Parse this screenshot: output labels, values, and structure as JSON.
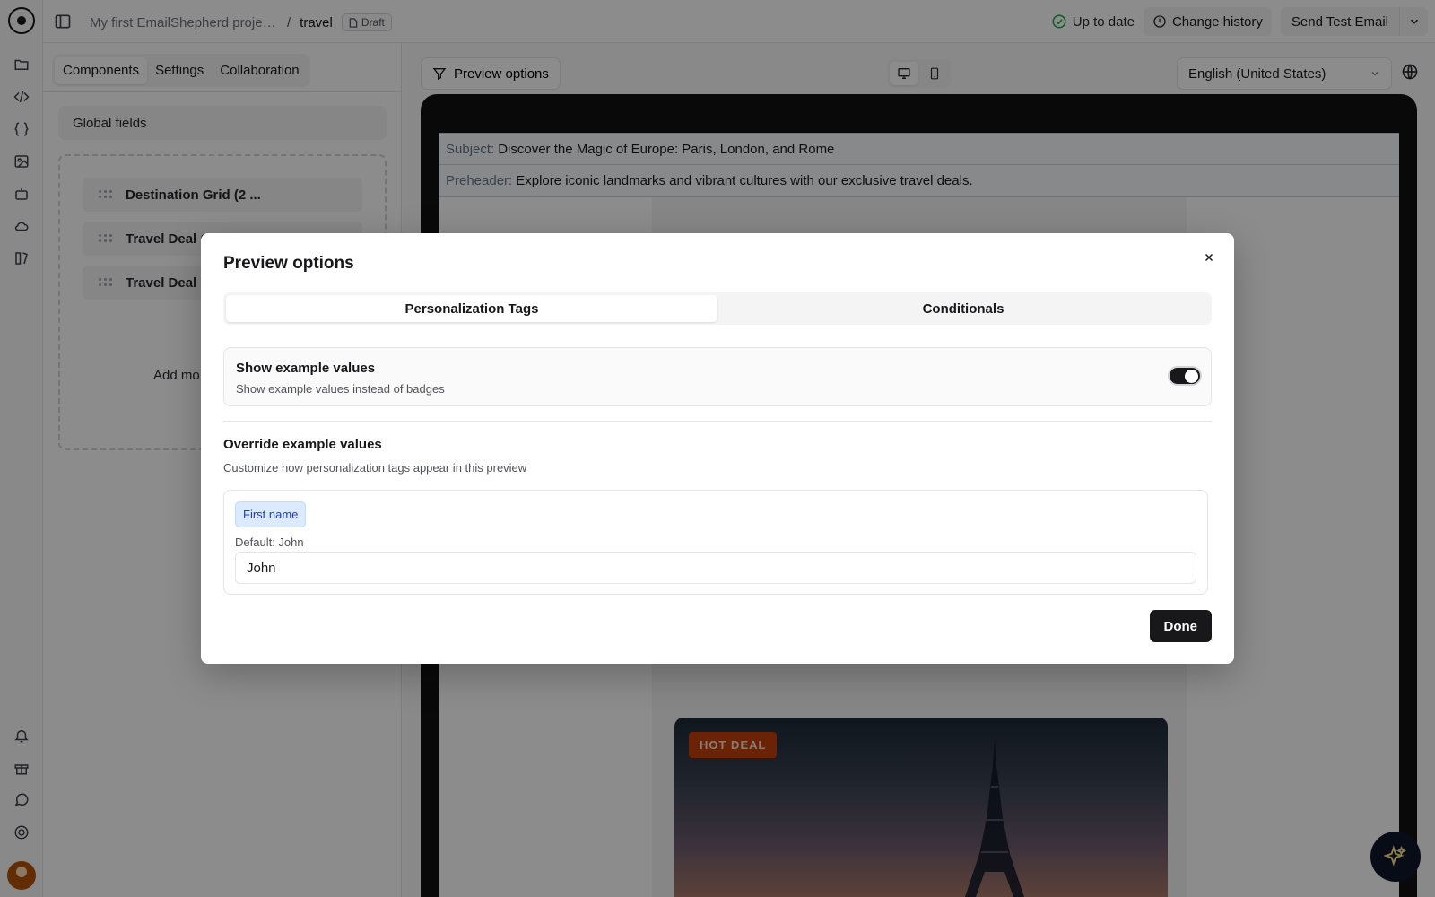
{
  "topbar": {
    "breadcrumb_project": "My first EmailShepherd projec...",
    "breadcrumb_separator": "/",
    "breadcrumb_current": "travel",
    "status_badge": "Draft",
    "sync_status": "Up to date",
    "change_history": "Change history",
    "send_test": "Send Test Email"
  },
  "panel": {
    "tabs": [
      "Components",
      "Settings",
      "Collaboration"
    ],
    "active_tab": "Components",
    "global_fields": "Global fields",
    "components": [
      "Destination Grid (2 ...",
      "Travel Deal C",
      "Travel Deal C"
    ],
    "add_more": "Add mo"
  },
  "canvas": {
    "preview_options": "Preview options",
    "language": "English (United States)",
    "subject_label": "Subject:",
    "subject": "Discover the Magic of Europe: Paris, London, and Rome",
    "preheader_label": "Preheader:",
    "preheader": "Explore iconic landmarks and vibrant cultures with our exclusive travel deals.",
    "hero_badge": "HOT DEAL"
  },
  "modal": {
    "title": "Preview options",
    "tabs": [
      "Personalization Tags",
      "Conditionals"
    ],
    "active_tab": "Personalization Tags",
    "show_examples_title": "Show example values",
    "show_examples_desc": "Show example values instead of badges",
    "show_examples_enabled": true,
    "override_title": "Override example values",
    "override_desc": "Customize how personalization tags appear in this preview",
    "field_tag": "First name",
    "field_default": "Default: John",
    "field_value": "John",
    "done": "Done"
  },
  "icons": [
    "logo-icon",
    "sidebar-toggle-icon",
    "folder-icon",
    "code-icon",
    "braces-icon",
    "image-icon",
    "robot-icon",
    "cloud-icon",
    "settings-icon",
    "bell-icon",
    "gift-icon",
    "chat-icon",
    "help-icon",
    "check-circle-icon",
    "clock-icon",
    "chevron-down-icon",
    "filter-icon",
    "desktop-icon",
    "mobile-icon",
    "globe-icon",
    "close-icon",
    "sparkle-icon"
  ],
  "colors": {
    "overlay": "rgba(0,0,0,0.45)",
    "primary": "#18181b",
    "tag_bg": "#dbeafe",
    "hot_deal": "#c2410c"
  }
}
